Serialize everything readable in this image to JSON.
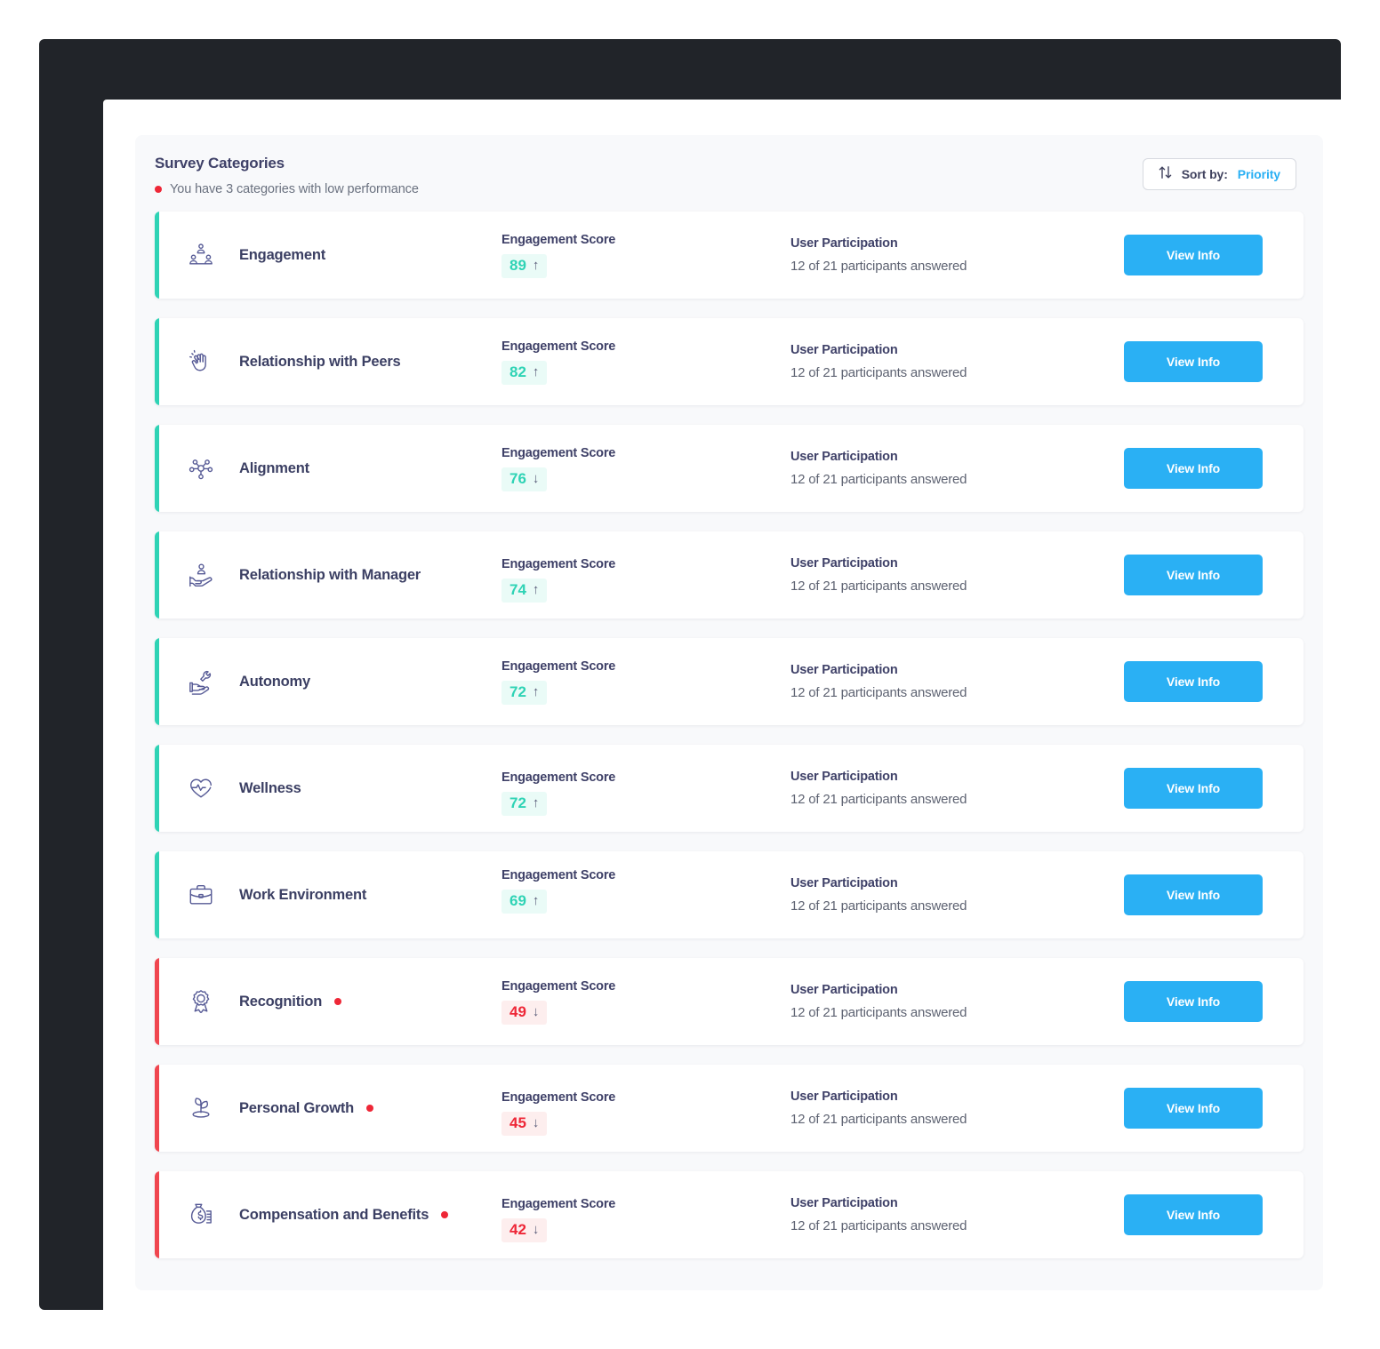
{
  "panel": {
    "title": "Survey Categories",
    "alert_text": "You have 3 categories with low performance",
    "alert_dot_color": "#ee2737"
  },
  "sort_control": {
    "icon": "sort-arrows-icon",
    "label": "Sort by:",
    "value": "Priority",
    "value_color": "#2ab0f4"
  },
  "labels": {
    "score_label": "Engagement Score",
    "participation_label": "User Participation",
    "view_info": "View Info"
  },
  "colors": {
    "good": "#2fd3b5",
    "good_bg": "#eafbf7",
    "low": "#ee2737",
    "low_bar": "#f0464f",
    "low_bg": "#fdeeee",
    "accent_blue": "#2ab0f4",
    "panel_bg": "#f8f9fb",
    "bezel": "#212429"
  },
  "categories": [
    {
      "name": "Engagement",
      "icon": "team-hierarchy-icon",
      "score": "89",
      "trend": "up",
      "status": "good",
      "low_flag": false,
      "score_label": "Engagement Score",
      "participation_label": "User Participation",
      "participation": "12 of 21 participants answered",
      "action": "View Info"
    },
    {
      "name": "Relationship with Peers",
      "icon": "high-five-hands-icon",
      "score": "82",
      "trend": "up",
      "status": "good",
      "low_flag": false,
      "score_label": "Engagement Score",
      "participation_label": "User Participation",
      "participation": "12 of 21 participants answered",
      "action": "View Info"
    },
    {
      "name": "Alignment",
      "icon": "network-nodes-icon",
      "score": "76",
      "trend": "down",
      "status": "good",
      "low_flag": false,
      "score_label": "Engagement Score",
      "participation_label": "User Participation",
      "participation": "12 of 21 participants answered",
      "action": "View Info"
    },
    {
      "name": "Relationship with Manager",
      "icon": "hand-holding-person-icon",
      "score": "74",
      "trend": "up",
      "status": "good",
      "low_flag": false,
      "score_label": "Engagement Score",
      "participation_label": "User Participation",
      "participation": "12 of 21 participants answered",
      "action": "View Info"
    },
    {
      "name": "Autonomy",
      "icon": "hand-holding-wrench-icon",
      "score": "72",
      "trend": "up",
      "status": "good",
      "low_flag": false,
      "score_label": "Engagement Score",
      "participation_label": "User Participation",
      "participation": "12 of 21 participants answered",
      "action": "View Info"
    },
    {
      "name": "Wellness",
      "icon": "heart-pulse-icon",
      "score": "72",
      "trend": "up",
      "status": "good",
      "low_flag": false,
      "score_label": "Engagement Score",
      "participation_label": "User Participation",
      "participation": "12 of 21 participants answered",
      "action": "View Info"
    },
    {
      "name": "Work Environment",
      "icon": "briefcase-icon",
      "score": "69",
      "trend": "up",
      "status": "good",
      "low_flag": false,
      "score_label": "Engagement Score",
      "participation_label": "User Participation",
      "participation": "12 of 21 participants answered",
      "action": "View Info"
    },
    {
      "name": "Recognition",
      "icon": "award-ribbon-icon",
      "score": "49",
      "trend": "down",
      "status": "low",
      "low_flag": true,
      "score_label": "Engagement Score",
      "participation_label": "User Participation",
      "participation": "12 of 21 participants answered",
      "action": "View Info"
    },
    {
      "name": "Personal Growth",
      "icon": "sprout-plant-icon",
      "score": "45",
      "trend": "down",
      "status": "low",
      "low_flag": true,
      "score_label": "Engagement Score",
      "participation_label": "User Participation",
      "participation": "12 of 21 participants answered",
      "action": "View Info"
    },
    {
      "name": "Compensation and Benefits",
      "icon": "money-bag-icon",
      "score": "42",
      "trend": "down",
      "status": "low",
      "low_flag": true,
      "score_label": "Engagement Score",
      "participation_label": "User Participation",
      "participation": "12 of 21 participants answered",
      "action": "View Info"
    }
  ]
}
